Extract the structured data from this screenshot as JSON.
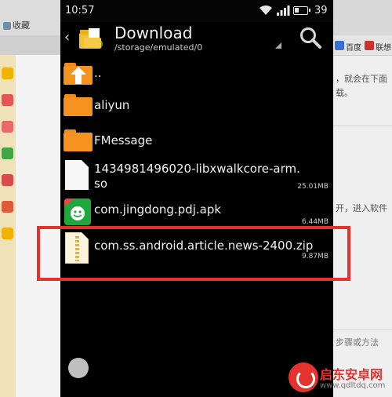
{
  "status_bar": {
    "time": "10:57",
    "battery": "39",
    "battery_level_percent": 39
  },
  "header": {
    "back_glyph": "‹",
    "title": "Download",
    "path": "/storage/emulated/0"
  },
  "files": [
    {
      "name": "..",
      "size": "",
      "icon": "folder-up-icon"
    },
    {
      "name": "aliyun",
      "size": "",
      "icon": "folder-icon"
    },
    {
      "name": "FMessage",
      "size": "",
      "icon": "folder-icon"
    },
    {
      "name_line1": "1434981496020-libxwalkcore-arm.",
      "name_line2": "so",
      "size": "25.01MB",
      "icon": "document-icon"
    },
    {
      "name": "com.jingdong.pdj.apk",
      "size": "6.44MB",
      "icon": "apk-icon"
    },
    {
      "name": "com.ss.android.article.news-2400.zip",
      "size": "9.87MB",
      "icon": "zip-icon"
    }
  ],
  "background_browser": {
    "left_tab": "收藏",
    "right_tabs": [
      "百度",
      "联想"
    ],
    "right_text_1": "，就会在下面",
    "right_text_2": "载。",
    "right_text_3": "开，进入软件",
    "right_text_4": "步骤或方法"
  },
  "watermark": {
    "title": "启东安卓网",
    "url": "www.qdltdq.com"
  },
  "colors": {
    "folder": "#f6931f",
    "highlight": "#e3332f",
    "apk": "#1fa83e",
    "watermark": "#e6322e"
  }
}
